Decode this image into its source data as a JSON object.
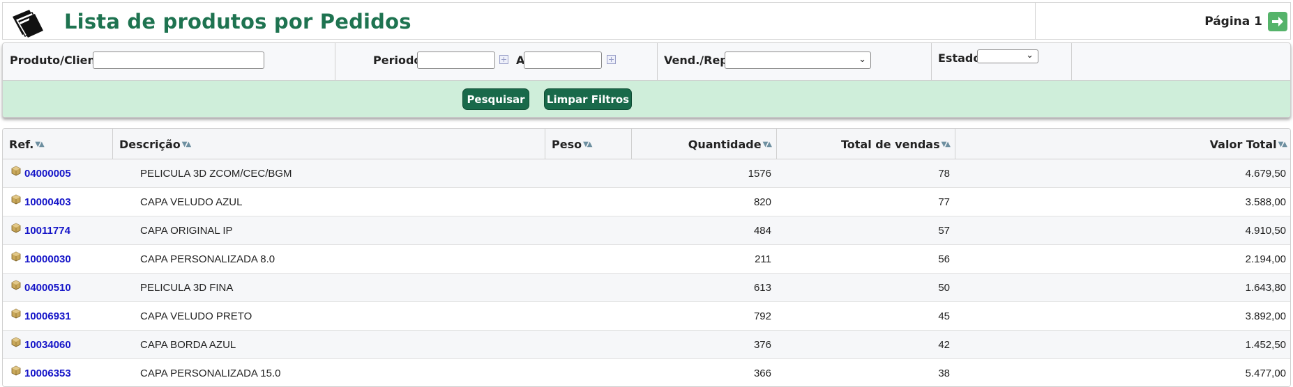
{
  "header": {
    "title": "Lista de produtos por Pedidos",
    "page_label": "Página 1"
  },
  "filters": {
    "produto_label": "Produto/Cliente:",
    "produto_value": "",
    "periodo_label": "Periodo:",
    "periodo_from": "",
    "periodo_sep": "A",
    "periodo_to": "",
    "vendedor_label": "Vend./Rep.:",
    "vendedor_value": "",
    "estado_label": "Estado:",
    "estado_value": "",
    "search_button": "Pesquisar",
    "clear_button": "Limpar Filtros"
  },
  "table": {
    "columns": [
      "Ref.",
      "Descrição",
      "Peso",
      "Quantidade",
      "Total de vendas",
      "Valor Total"
    ],
    "rows": [
      {
        "ref": "04000005",
        "descricao": "PELICULA 3D ZCOM/CEC/BGM",
        "peso": "",
        "quantidade": "1576",
        "total_vendas": "78",
        "valor_total": "4.679,50"
      },
      {
        "ref": "10000403",
        "descricao": "CAPA VELUDO AZUL",
        "peso": "",
        "quantidade": "820",
        "total_vendas": "77",
        "valor_total": "3.588,00"
      },
      {
        "ref": "10011774",
        "descricao": "CAPA ORIGINAL IP",
        "peso": "",
        "quantidade": "484",
        "total_vendas": "57",
        "valor_total": "4.910,50"
      },
      {
        "ref": "10000030",
        "descricao": "CAPA PERSONALIZADA 8.0",
        "peso": "",
        "quantidade": "211",
        "total_vendas": "56",
        "valor_total": "2.194,00"
      },
      {
        "ref": "04000510",
        "descricao": "PELICULA 3D FINA",
        "peso": "",
        "quantidade": "613",
        "total_vendas": "50",
        "valor_total": "1.643,80"
      },
      {
        "ref": "10006931",
        "descricao": "CAPA VELUDO PRETO",
        "peso": "",
        "quantidade": "792",
        "total_vendas": "45",
        "valor_total": "3.892,00"
      },
      {
        "ref": "10034060",
        "descricao": "CAPA BORDA AZUL",
        "peso": "",
        "quantidade": "376",
        "total_vendas": "42",
        "valor_total": "1.452,50"
      },
      {
        "ref": "10006353",
        "descricao": "CAPA PERSONALIZADA 15.0",
        "peso": "",
        "quantidade": "366",
        "total_vendas": "38",
        "valor_total": "5.477,00"
      }
    ]
  },
  "colors": {
    "title_green": "#1e7350",
    "button_green": "#19694a",
    "button_row_bg": "#cfeeda",
    "link_blue": "#1515c8",
    "next_arrow_green": "#55b36a"
  },
  "icons": {
    "header_logo": "folder-stack-icon",
    "next_page": "arrow-right-icon",
    "calendar": "calendar-icon",
    "row_item": "package-box-icon",
    "sort": "sort-arrows-icon",
    "select": "chevron-down-icon"
  }
}
